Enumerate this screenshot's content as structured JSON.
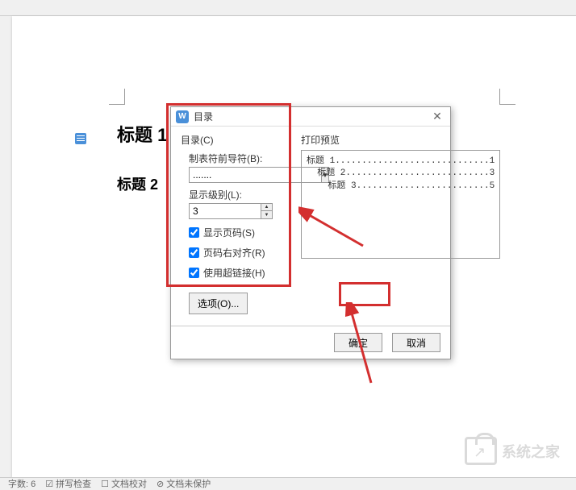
{
  "document": {
    "heading1": "标题 1",
    "heading2": "标题 2"
  },
  "dialog": {
    "title": "目录",
    "section_label": "目录(C)",
    "tab_leader_label": "制表符前导符(B):",
    "tab_leader_value": ".......",
    "level_label": "显示级别(L):",
    "level_value": "3",
    "check_show_page": "显示页码(S)",
    "check_right_align": "页码右对齐(R)",
    "check_hyperlink": "使用超链接(H)",
    "options_btn": "选项(O)...",
    "preview_label": "打印预览",
    "preview_line1": "标题 1.............................1",
    "preview_line2": "  标题 2...........................3",
    "preview_line3": "    标题 3.........................5",
    "ok": "确定",
    "cancel": "取消"
  },
  "statusbar": {
    "word_count": "字数: 6",
    "spell": "拼写检查",
    "proof": "文档校对",
    "unsaved": "文档未保护"
  },
  "watermark_text": "系统之家"
}
